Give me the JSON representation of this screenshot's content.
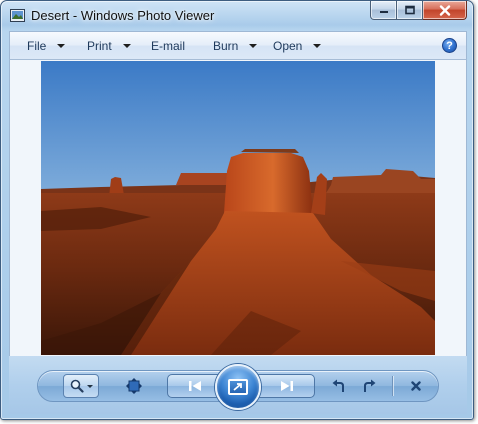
{
  "window": {
    "title": "Desert - Windows Photo Viewer"
  },
  "menubar": {
    "items": [
      {
        "label": "File",
        "has_dropdown": true
      },
      {
        "label": "Print",
        "has_dropdown": true
      },
      {
        "label": "E-mail",
        "has_dropdown": false
      },
      {
        "label": "Burn",
        "has_dropdown": true
      },
      {
        "label": "Open",
        "has_dropdown": true
      }
    ],
    "help_glyph": "?"
  },
  "photo": {
    "subject": "desert-mesa-photo"
  },
  "controls": {
    "icons": [
      "magnifier-icon",
      "actual-size-icon",
      "previous-icon",
      "slideshow-icon",
      "next-icon",
      "rotate-left-icon",
      "rotate-right-icon",
      "delete-icon"
    ]
  },
  "colors": {
    "frame": "#a9cbea",
    "close_button": "#c2452b",
    "slideshow_button": "#3e86d4",
    "sky_top": "#3f7fc8",
    "rock": "#b4441c"
  }
}
